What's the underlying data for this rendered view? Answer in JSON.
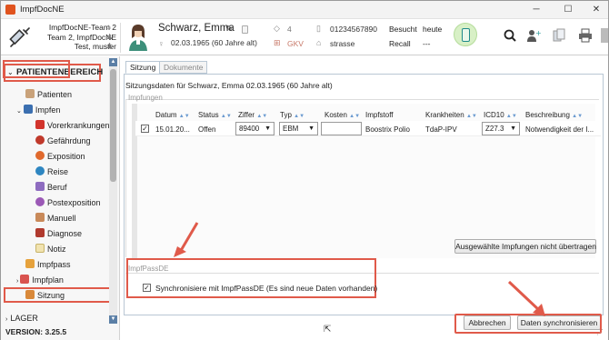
{
  "window": {
    "title": "ImpfDocNE",
    "min": "─",
    "max": "☐",
    "close": "✕"
  },
  "header": {
    "clinic_lines": [
      "ImpfDocNE-Team 2",
      "Team 2, ImpfDocNE",
      "Test, muster"
    ],
    "patient_name": "Schwarz, Emma",
    "patient_dob": "02.03.1965  (60 Jahre alt)",
    "count": "4",
    "insurance": "GKV",
    "phone": "01234567890",
    "street": "strasse",
    "status1_label": "Besucht",
    "status1_value": "heute",
    "status2_label": "Recall",
    "status2_value": "---"
  },
  "sidebar": {
    "section": "PATIENTENBEREICH",
    "items": [
      {
        "label": "Patienten"
      },
      {
        "label": "Impfen"
      },
      {
        "label": "Vorerkrankungen"
      },
      {
        "label": "Gefährdung"
      },
      {
        "label": "Exposition"
      },
      {
        "label": "Reise"
      },
      {
        "label": "Beruf"
      },
      {
        "label": "Postexposition"
      },
      {
        "label": "Manuell"
      },
      {
        "label": "Diagnose"
      },
      {
        "label": "Notiz"
      },
      {
        "label": "Impfpass"
      },
      {
        "label": "Impfplan"
      },
      {
        "label": "Sitzung"
      }
    ],
    "lager": "LAGER",
    "version": "VERSION: 3.25.5"
  },
  "tabs": [
    "Sitzung",
    "Dokumente"
  ],
  "sitzung_title": "Sitzungsdaten für Schwarz, Emma 02.03.1965 (60 Jahre alt)",
  "impfungen": {
    "title": "Impfungen",
    "columns": [
      "Datum",
      "Status",
      "Ziffer",
      "Typ",
      "Kosten",
      "Impfstoff",
      "Krankheiten",
      "ICD10",
      "Beschreibung"
    ],
    "row": {
      "datum": "15.01.20...",
      "status": "Offen",
      "ziffer": "89400",
      "typ": "EBM",
      "kosten": "",
      "impfstoff": "Boostrix Polio",
      "krankheiten": "TdaP-IPV",
      "icd10": "Z27.3",
      "beschreibung": "Notwendigkeit der I..."
    },
    "button": "Ausgewählte Impfungen nicht übertragen"
  },
  "impfpass": {
    "title": "ImpfPassDE",
    "sync_label": "Synchronisiere mit ImpfPassDE (Es sind neue Daten vorhanden)"
  },
  "footer": {
    "cancel": "Abbrechen",
    "sync": "Daten synchronisieren"
  },
  "colors": {
    "highlight": "#e05a4a",
    "accent": "#5b7fa6"
  }
}
